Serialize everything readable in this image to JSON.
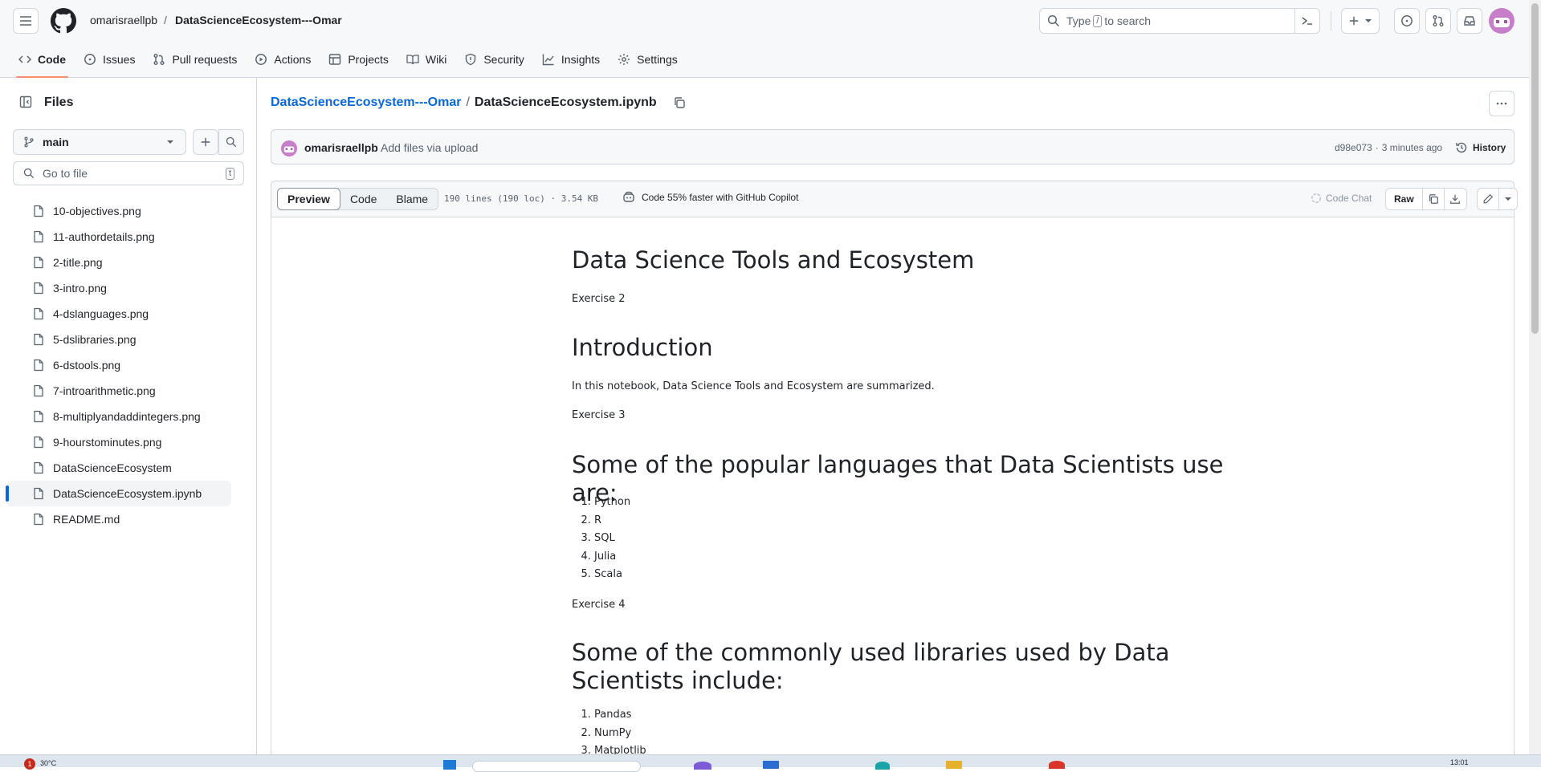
{
  "header": {
    "owner": "omarisraellpb",
    "separator": "/",
    "repo": "DataScienceEcosystem---Omar",
    "search_pre": "Type",
    "search_key": "/",
    "search_post": "to search"
  },
  "nav": {
    "tabs": [
      {
        "label": "Code",
        "icon": "code-icon"
      },
      {
        "label": "Issues",
        "icon": "issue-icon"
      },
      {
        "label": "Pull requests",
        "icon": "pull-request-icon"
      },
      {
        "label": "Actions",
        "icon": "play-icon"
      },
      {
        "label": "Projects",
        "icon": "table-icon"
      },
      {
        "label": "Wiki",
        "icon": "book-icon"
      },
      {
        "label": "Security",
        "icon": "shield-icon"
      },
      {
        "label": "Insights",
        "icon": "graph-icon"
      },
      {
        "label": "Settings",
        "icon": "gear-icon"
      }
    ]
  },
  "sidebar": {
    "title": "Files",
    "branch": "main",
    "goto_placeholder": "Go to file",
    "goto_key": "t",
    "files": [
      "10-objectives.png",
      "11-authordetails.png",
      "2-title.png",
      "3-intro.png",
      "4-dslanguages.png",
      "5-dslibraries.png",
      "6-dstools.png",
      "7-introarithmetic.png",
      "8-multiplyandaddintegers.png",
      "9-hourstominutes.png",
      "DataScienceEcosystem",
      "DataScienceEcosystem.ipynb",
      "README.md"
    ],
    "selected_file": "DataScienceEcosystem.ipynb"
  },
  "file": {
    "repo_link": "DataScienceEcosystem---Omar",
    "separator": "/",
    "name": "DataScienceEcosystem.ipynb"
  },
  "commit": {
    "author": "omarisraellpb",
    "message": "Add files via upload",
    "sha": "d98e073",
    "dot": "·",
    "time": "3 minutes ago",
    "history_label": "History"
  },
  "toolbar": {
    "preview": "Preview",
    "code": "Code",
    "blame": "Blame",
    "stats": "190 lines (190 loc) · 3.54 KB",
    "copilot": "Code 55% faster with GitHub Copilot",
    "code_chat": "Code Chat",
    "raw": "Raw"
  },
  "notebook": {
    "title": "Data Science Tools and Ecosystem",
    "ex2": "Exercise 2",
    "intro_heading": "Introduction",
    "intro_text": "In this notebook, Data Science Tools and Ecosystem are summarized.",
    "ex3": "Exercise 3",
    "languages_heading": "Some of the popular languages that Data Scientists use are:",
    "languages": [
      "Python",
      "R",
      "SQL",
      "Julia",
      "Scala"
    ],
    "ex4": "Exercise 4",
    "libraries_heading": "Some of the commonly used libraries used by Data Scientists include:",
    "libraries": [
      "Pandas",
      "NumPy",
      "Matplotlib"
    ]
  },
  "taskbar": {
    "weather": "30°C",
    "badge": "1",
    "time": "13:01"
  },
  "colors": {
    "link": "#0969da",
    "border": "#d0d7de",
    "selected_tab_underline": "#fd8c73",
    "header_bg": "#f6f8fa"
  }
}
